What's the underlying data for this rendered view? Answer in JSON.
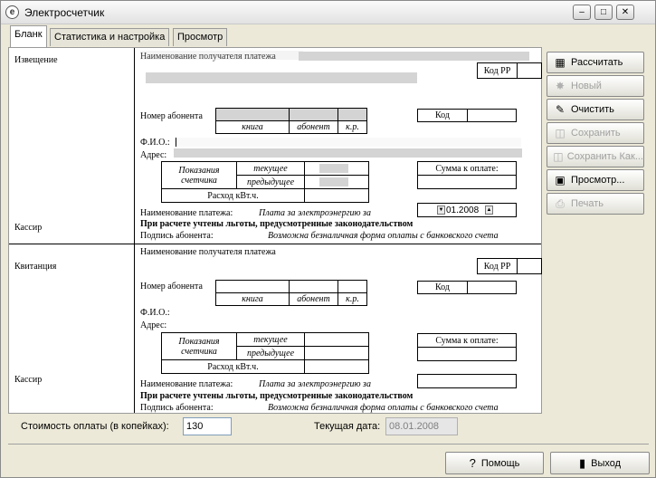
{
  "window": {
    "title": "Электросчетчик"
  },
  "tabs": [
    {
      "label": "Бланк"
    },
    {
      "label": "Статистика и настройка"
    },
    {
      "label": "Просмотр"
    }
  ],
  "notice": {
    "section_label": "Извещение",
    "cashier_label": "Кассир",
    "recipient_label": "Наименование получателя платежа",
    "code_rr_label": "Код РР",
    "account_label": "Номер абонента",
    "book_label": "книга",
    "subscriber_label": "абонент",
    "kr_label": "к.р.",
    "code_label": "Код",
    "fio_label": "Ф.И.О.:",
    "address_label": "Адрес:",
    "meter_readings_label": "Показания счетчика",
    "current_label": "текущее",
    "previous_label": "предыдущее",
    "consumption_label": "Расход кВт.ч.",
    "amount_due_label": "Сумма к оплате:",
    "payment_name_label": "Наименование платежа:",
    "payment_name_value": "Плата за электроэнергию за",
    "period_value": "01.2008",
    "benefits_note": "При расчете учтены льготы, предусмотренные законодательством",
    "signature_label": "Подпись абонента:",
    "cashless_note": "Возможна безналичная форма оплаты с банковского счета"
  },
  "receipt": {
    "section_label": "Квитанция",
    "cashier_label": "Кассир",
    "recipient_label": "Наименование получателя платежа",
    "code_rr_label": "Код РР",
    "account_label": "Номер абонента",
    "book_label": "книга",
    "subscriber_label": "абонент",
    "kr_label": "к.р.",
    "code_label": "Код",
    "fio_label": "Ф.И.О.:",
    "address_label": "Адрес:",
    "meter_readings_label": "Показания счетчика",
    "current_label": "текущее",
    "previous_label": "предыдущее",
    "consumption_label": "Расход кВт.ч.",
    "amount_due_label": "Сумма к оплате:",
    "payment_name_label": "Наименование платежа:",
    "payment_name_value": "Плата за электроэнергию за",
    "benefits_note": "При расчете учтены льготы, предусмотренные законодательством",
    "signature_label": "Подпись абонента:",
    "cashless_note": "Возможна безналичная форма оплаты с банковского счета"
  },
  "footer": {
    "cost_label": "Стоимость оплаты (в копейках):",
    "cost_value": "130",
    "date_label": "Текущая дата:",
    "date_value": "08.01.2008"
  },
  "sidebar_buttons": [
    {
      "label": "Рассчитать",
      "icon": "calculator-icon",
      "enabled": true
    },
    {
      "label": "Новый",
      "icon": "new-sparkle-icon",
      "enabled": false
    },
    {
      "label": "Очистить",
      "icon": "eraser-icon",
      "enabled": true
    },
    {
      "label": "Сохранить",
      "icon": "save-icon",
      "enabled": false
    },
    {
      "label": "Сохранить Как...",
      "icon": "save-as-icon",
      "enabled": false
    },
    {
      "label": "Просмотр...",
      "icon": "floppy-icon",
      "enabled": true
    },
    {
      "label": "Печать",
      "icon": "printer-icon",
      "enabled": false
    }
  ],
  "bottom_buttons": {
    "help_label": "Помощь",
    "exit_label": "Выход"
  }
}
